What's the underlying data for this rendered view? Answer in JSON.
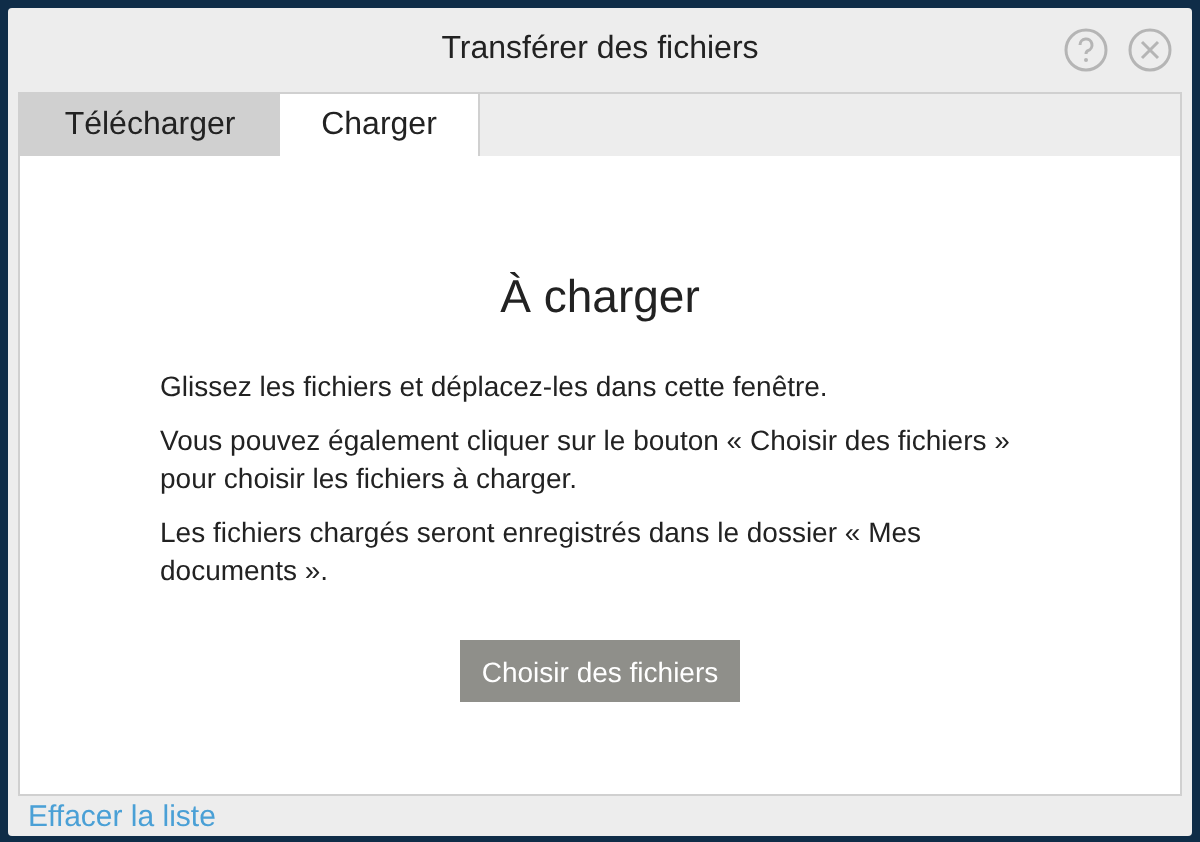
{
  "window": {
    "title": "Transférer des fichiers"
  },
  "tabs": [
    {
      "label": "Télécharger",
      "selected": false
    },
    {
      "label": "Charger",
      "selected": true
    }
  ],
  "panel": {
    "heading": "À charger",
    "paragraphs": [
      "Glissez les fichiers et déplacez-les dans cette fenêtre.",
      "Vous pouvez également cliquer sur le bouton « Choisir des fichiers » pour choisir les fichiers à charger.",
      "Les fichiers chargés seront enregistrés dans le dossier « Mes documents »."
    ],
    "button": "Choisir des fichiers"
  },
  "footer": {
    "link": "Effacer la liste"
  }
}
